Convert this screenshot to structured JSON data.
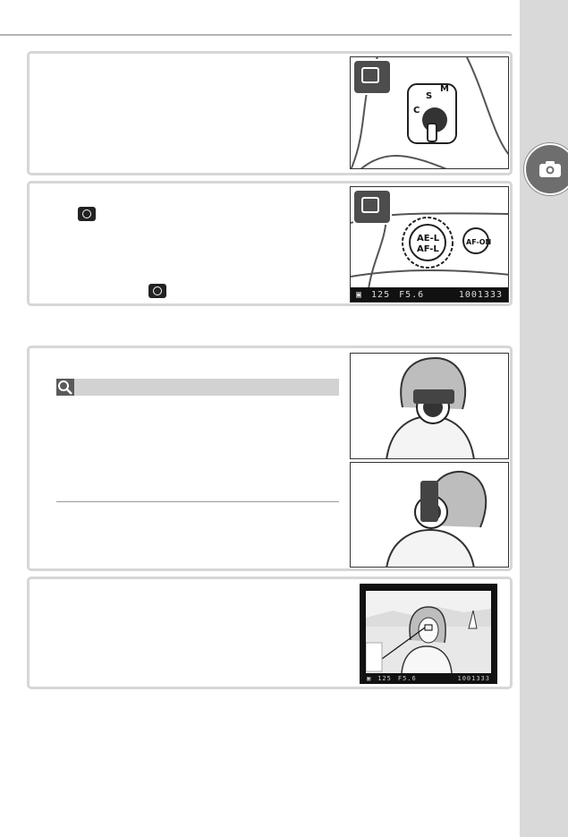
{
  "panel2": {
    "lcd": {
      "shutter": "125",
      "aperture": "F5.6",
      "frames": "1001333"
    }
  },
  "panel4": {
    "viewfinder": {
      "shutter": "125",
      "aperture": "F5.6",
      "frames": "1001333"
    }
  },
  "icons": {
    "side_tab": "camera-icon",
    "tip": "magnifier-icon",
    "meter": "matrix-metering-icon"
  }
}
